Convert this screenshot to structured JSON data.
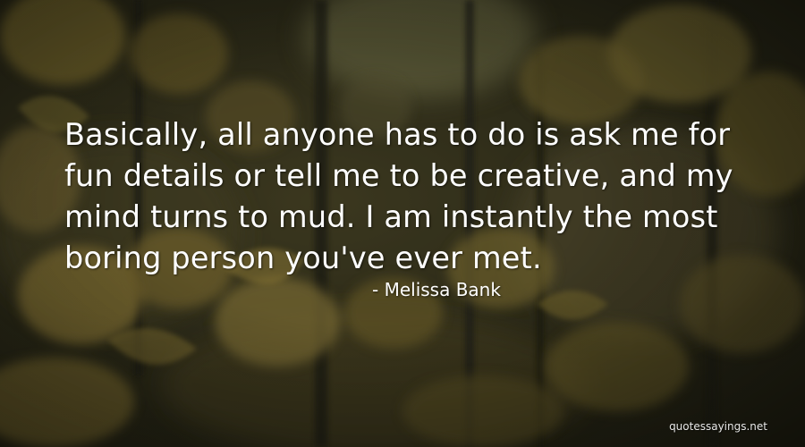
{
  "quote": {
    "lines": [
      "Basically, all anyone has to do is ask me for",
      "fun details or tell me to be creative, and my",
      "mind turns to mud. I am instantly the most",
      "boring person you've ever met."
    ],
    "author": "- Melissa Bank"
  },
  "watermark": "quotessayings.net",
  "colors": {
    "text": "#ffffff",
    "background_dark": "#2b2a1c",
    "foliage_gold": "#8a7a3a"
  }
}
